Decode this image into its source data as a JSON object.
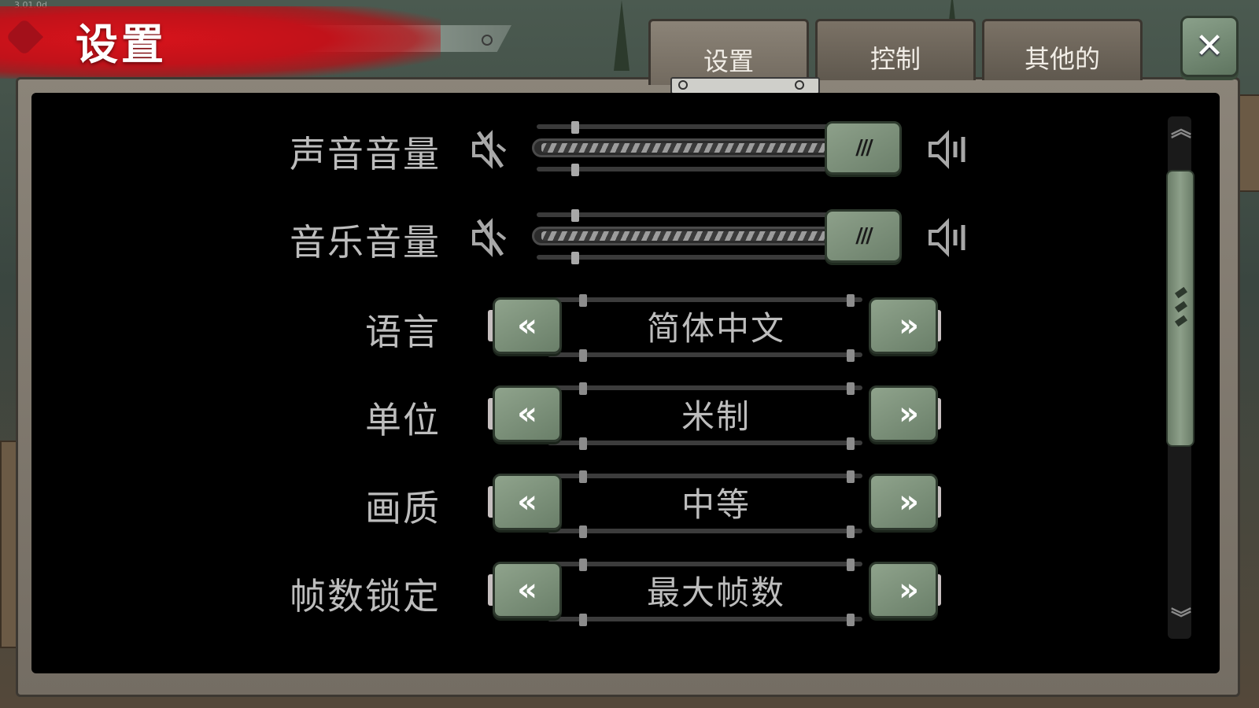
{
  "header": {
    "version": "3.01.0d",
    "title": "设置"
  },
  "tabs": [
    {
      "label": "设置",
      "active": true
    },
    {
      "label": "控制",
      "active": false
    },
    {
      "label": "其他的",
      "active": false
    }
  ],
  "close": {
    "icon": "close-icon",
    "glyph": "✕"
  },
  "settings": {
    "sound_volume": {
      "label": "声音音量",
      "value": 1.0
    },
    "music_volume": {
      "label": "音乐音量",
      "value": 1.0
    },
    "language": {
      "label": "语言",
      "value": "简体中文"
    },
    "units": {
      "label": "单位",
      "value": "米制"
    },
    "quality": {
      "label": "画质",
      "value": "中等"
    },
    "fps_lock": {
      "label": "帧数锁定",
      "value": "最大帧数"
    }
  },
  "glyphs": {
    "arrow_left": "«",
    "arrow_right": "»",
    "thumb_grip": "///",
    "scroll_up": "︽",
    "scroll_down": "︾"
  },
  "colors": {
    "accent_red": "#d8131b",
    "button_green": "#8da08a",
    "panel_bg": "#000000",
    "label_gray": "#bdbdbd"
  }
}
